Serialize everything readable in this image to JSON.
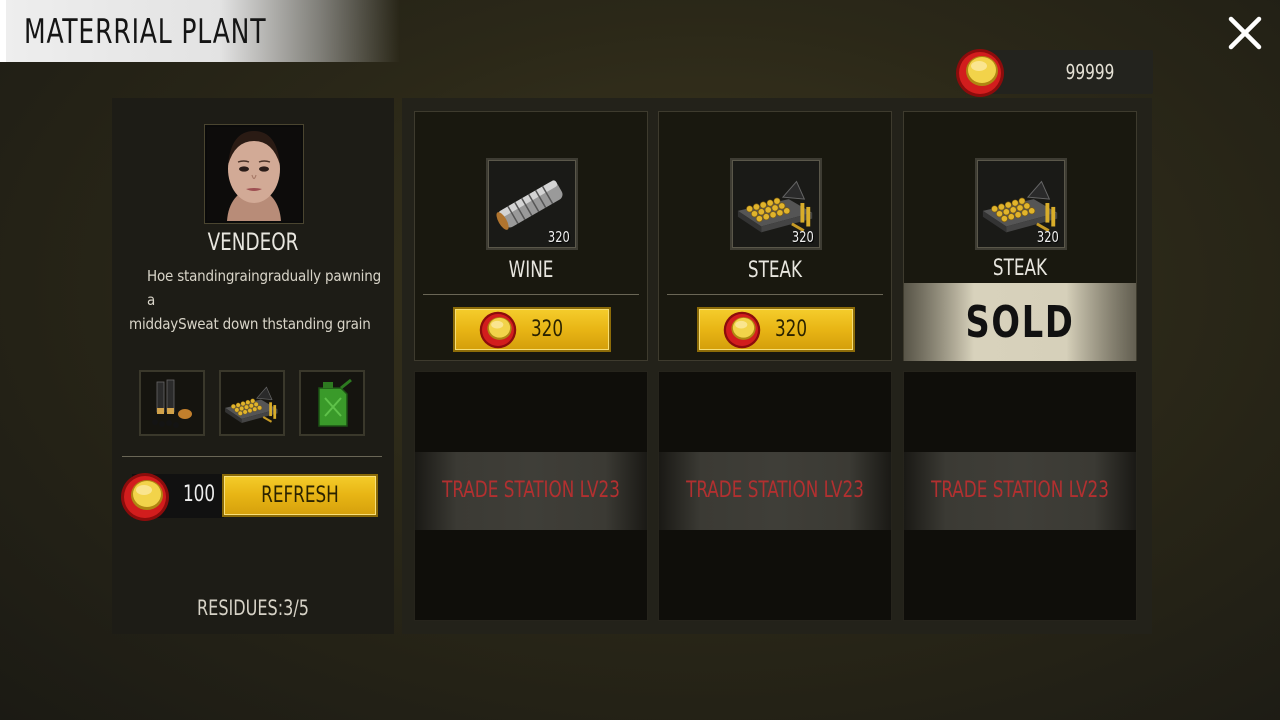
{
  "window": {
    "title": "MATERRIAL PLANT",
    "close_icon": "close-icon"
  },
  "currency": {
    "icon": "coin-icon",
    "amount": "99999"
  },
  "vendor": {
    "name": "VENDEOR",
    "description_line1": "Hoe standingraingradually pawning a",
    "description_line2": "middaySweat down thstanding grain",
    "inventory_icons": [
      "shotgun-shells-icon",
      "ammo-box-icon",
      "fuel-can-icon"
    ],
    "refresh_cost": "100",
    "refresh_label": "REFRESH",
    "residues": "RESIDUES:3/5"
  },
  "shop": {
    "items": [
      {
        "name": "WINE",
        "icon": "pipe-icon",
        "quantity": "320",
        "price": "320",
        "status": "available"
      },
      {
        "name": "STEAK",
        "icon": "ammo-box-icon",
        "quantity": "320",
        "price": "320",
        "status": "available"
      },
      {
        "name": "STEAK",
        "icon": "ammo-box-icon",
        "quantity": "320",
        "status": "sold",
        "sold_label": "SOLD"
      }
    ],
    "locked_slots": [
      {
        "label": "TRADE STATION LV23"
      },
      {
        "label": "TRADE STATION LV23"
      },
      {
        "label": "TRADE STATION LV23"
      }
    ]
  },
  "colors": {
    "accent_gold": "#e8b515",
    "coin_red": "#c41818",
    "locked_text": "#b23030"
  }
}
